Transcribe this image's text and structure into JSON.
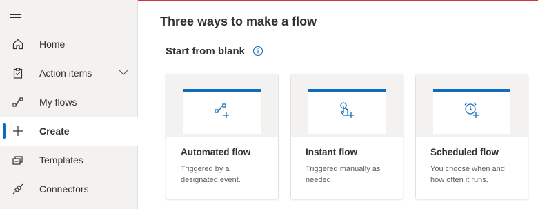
{
  "sidebar": {
    "items": [
      {
        "label": "Home",
        "icon": "home-icon"
      },
      {
        "label": "Action items",
        "icon": "clipboard-icon"
      },
      {
        "label": "My flows",
        "icon": "flow-icon"
      },
      {
        "label": "Create",
        "icon": "plus-icon",
        "active": true
      },
      {
        "label": "Templates",
        "icon": "templates-icon"
      },
      {
        "label": "Connectors",
        "icon": "connector-icon"
      }
    ]
  },
  "main": {
    "title": "Three ways to make a flow",
    "section_title": "Start from blank",
    "cards": [
      {
        "title": "Automated flow",
        "desc": "Triggered by a designated event.",
        "icon": "automated-flow-icon"
      },
      {
        "title": "Instant flow",
        "desc": "Triggered manually as needed.",
        "icon": "touch-hand-icon"
      },
      {
        "title": "Scheduled flow",
        "desc": "You choose when and how often it runs.",
        "icon": "alarm-clock-icon"
      }
    ]
  },
  "colors": {
    "accent": "#0f6cbd",
    "sidebar_bg": "#f3f2f1",
    "top_border": "#d13438"
  }
}
